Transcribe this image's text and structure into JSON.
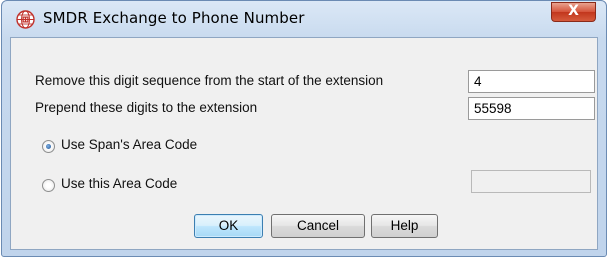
{
  "dialog": {
    "title": "SMDR Exchange to Phone Number",
    "close_glyph": "X",
    "icon": "globe-phone-icon"
  },
  "fields": {
    "remove_label": "Remove this digit sequence from the start of the extension",
    "remove_value": "4",
    "prepend_label": "Prepend these digits to the extension",
    "prepend_value": "55598"
  },
  "area_code": {
    "use_span_label": "Use Span's Area Code",
    "use_span_selected": true,
    "use_this_label": "Use this Area Code",
    "use_this_selected": false,
    "area_code_value": ""
  },
  "buttons": {
    "ok": "OK",
    "cancel": "Cancel",
    "help": "Help"
  },
  "colors": {
    "window_frame": "#c7d9ee",
    "close_button": "#c7432a",
    "icon_red": "#c0312b"
  }
}
